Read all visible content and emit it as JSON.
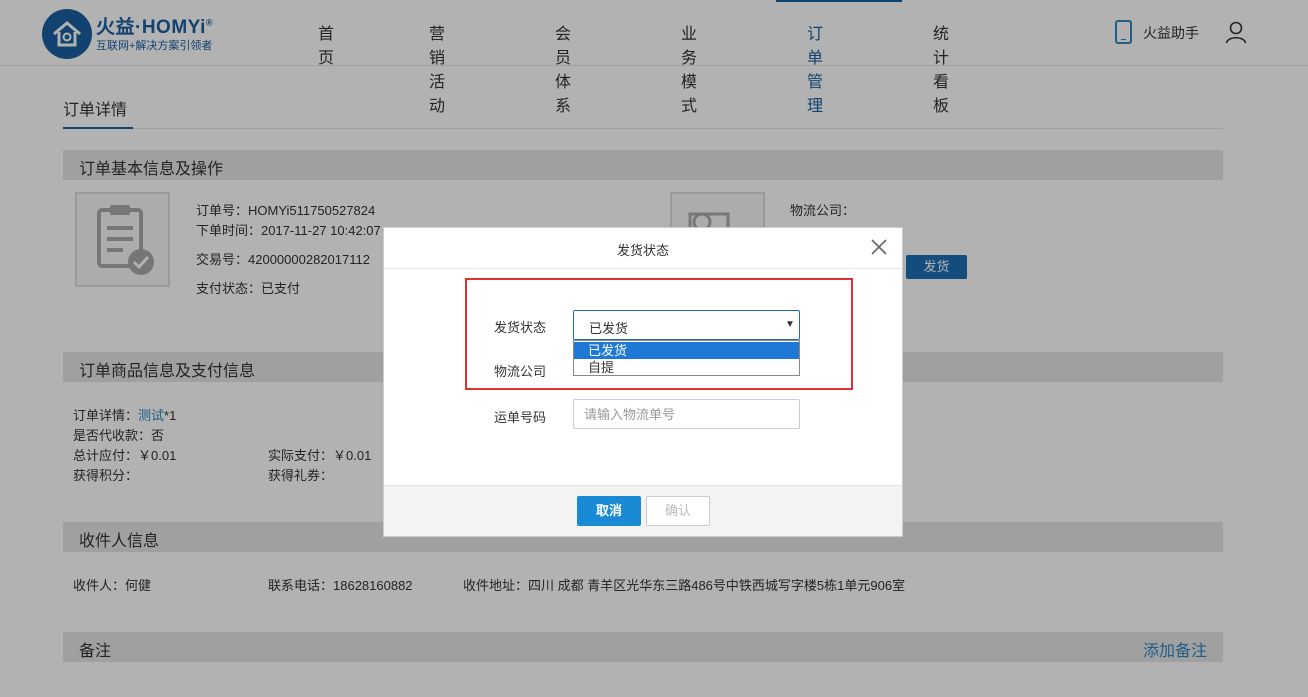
{
  "header": {
    "logo_main": "火益·HOMYi",
    "logo_sup": "®",
    "logo_sub": "互联网+解决方案引领者",
    "nav": [
      "首页",
      "营销活动",
      "会员体系",
      "业务模式",
      "订单管理",
      "统计看板"
    ],
    "active_nav": "订单管理",
    "assistant_label": "火益助手"
  },
  "page": {
    "tab": "订单详情",
    "sections": {
      "basic": "订单基本信息及操作",
      "goods": "订单商品信息及支付信息",
      "receiver": "收件人信息",
      "note": "备注"
    },
    "basic": {
      "order_no": "订单号：HOMYi511750527824",
      "order_time": "下单时间：2017-11-27 10:42:07",
      "trade_no": "交易号：42000000282017112",
      "pay_status": "支付状态：已支付",
      "logistics_company": "物流公司：",
      "ship_button": "发货"
    },
    "goods": {
      "detail_prefix": "订单详情：",
      "detail_link": "测试",
      "detail_suffix": "*1",
      "cod": "是否代收款：否",
      "total_due": "总计应付：￥0.01",
      "actual_paid": "实际支付：￥0.01",
      "points": "获得积分：",
      "coupons": "获得礼券："
    },
    "receiver": {
      "name": "收件人：何健",
      "phone": "联系电话：18628160882",
      "address": "收件地址：四川 成都 青羊区光华东三路486号中铁西城写字楼5栋1单元906室"
    },
    "add_note": "添加备注"
  },
  "modal": {
    "title": "发货状态",
    "status_label": "发货状态",
    "status_value": "已发货",
    "status_options": [
      "已发货",
      "自提"
    ],
    "logistics_label": "物流公司",
    "waybill_label": "运单号码",
    "waybill_placeholder": "请输入物流单号",
    "cancel": "取消",
    "confirm": "确认"
  },
  "colors": {
    "brand": "#1a5fa0",
    "primary_button": "#1a8ad4",
    "highlight_frame": "#e03030",
    "dropdown_selected": "#1e78d6"
  }
}
